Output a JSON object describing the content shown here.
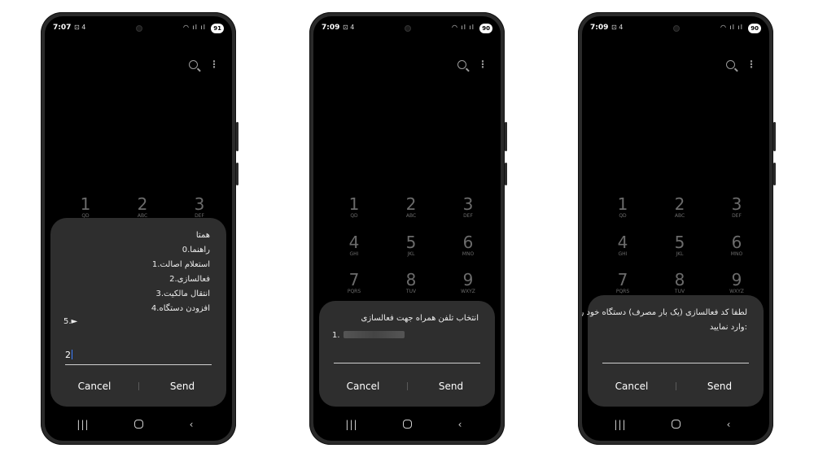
{
  "keys": [
    {
      "digit": "1",
      "letters": "QD"
    },
    {
      "digit": "2",
      "letters": "ABC"
    },
    {
      "digit": "3",
      "letters": "DEF"
    },
    {
      "digit": "4",
      "letters": "GHI"
    },
    {
      "digit": "5",
      "letters": "JKL"
    },
    {
      "digit": "6",
      "letters": "MNO"
    },
    {
      "digit": "7",
      "letters": "PQRS"
    },
    {
      "digit": "8",
      "letters": "TUV"
    },
    {
      "digit": "9",
      "letters": "WXYZ"
    }
  ],
  "phones": [
    {
      "time": "7:07",
      "notif": "⊡ 4",
      "status_icons": "◠ ıl ıl",
      "battery": "91",
      "dialog": {
        "lines": [
          "همتا",
          "0.راهنما",
          "1.استعلام اصالت",
          "2.فعالسازی",
          "3.انتقال مالکیت",
          "4.افزودن دستگاه"
        ],
        "extra": "5.►",
        "input": "2",
        "cancel": "Cancel",
        "send": "Send"
      },
      "peek": "Keypad"
    },
    {
      "time": "7:09",
      "notif": "⊡ 4",
      "status_icons": "◠ ıl ıl",
      "battery": "90",
      "dialog": {
        "lines": [
          "انتخاب تلفن همراه جهت فعالسازی"
        ],
        "extra": "1.",
        "input": "",
        "cancel": "Cancel",
        "send": "Send"
      },
      "peek": "Keypad"
    },
    {
      "time": "7:09",
      "notif": "⊡ 4",
      "status_icons": "◠ ıl ıl",
      "battery": "90",
      "dialog": {
        "lines": [
          "لطفا کد فعالسازی (یک بار مصرف) دستگاه خود را",
          "وارد نمایید:"
        ],
        "extra": "",
        "input": "",
        "cancel": "Cancel",
        "send": "Send"
      },
      "peek": ""
    }
  ],
  "nav": {
    "recent": "|||",
    "back": "‹"
  },
  "icons": {
    "search": "search-icon",
    "more": "⋮"
  }
}
